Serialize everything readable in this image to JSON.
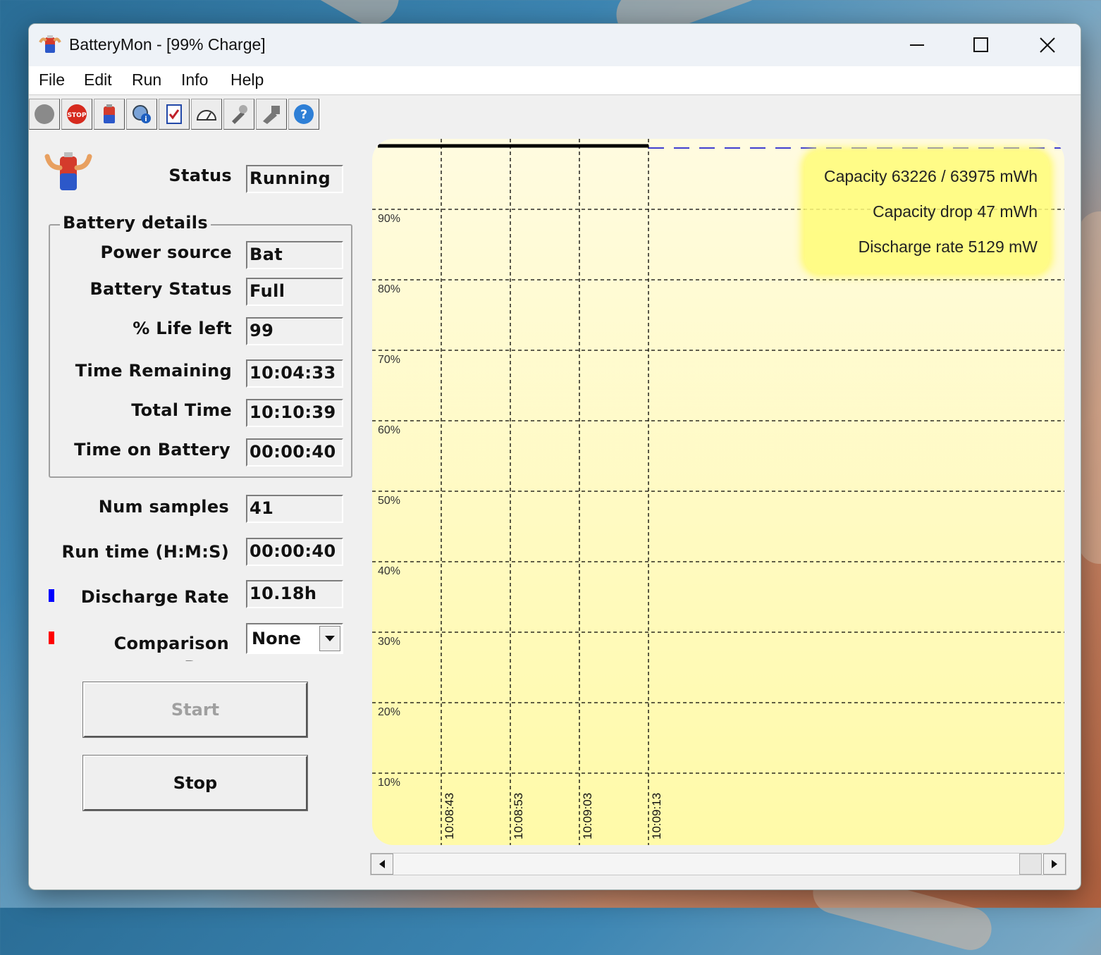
{
  "window": {
    "title": "BatteryMon - [99% Charge]",
    "minimize_icon": "minimize-icon",
    "maximize_icon": "maximize-icon",
    "close_icon": "close-icon"
  },
  "menu": [
    "File",
    "Edit",
    "Run",
    "Info",
    "Help"
  ],
  "toolbar": {
    "buttons": [
      "record-icon",
      "stop-icon",
      "battery-icon",
      "settings-icon",
      "checklist-icon",
      "gauge-icon",
      "tools-icon",
      "tools-gray-icon",
      "help-icon"
    ]
  },
  "status": {
    "label": "Status",
    "value": "Running"
  },
  "battery_details": {
    "title": "Battery details",
    "rows": [
      {
        "label": "Power source",
        "value": "Bat"
      },
      {
        "label": "Battery Status",
        "value": "Full"
      },
      {
        "label": "% Life left",
        "value": "99"
      },
      {
        "label": "Time Remaining",
        "value": "10:04:33"
      },
      {
        "label": "Total Time",
        "value": "10:10:39"
      },
      {
        "label": "Time on Battery",
        "value": "00:00:40"
      }
    ]
  },
  "stats": {
    "num_samples": {
      "label": "Num samples",
      "value": "41"
    },
    "run_time": {
      "label": "Run time (H:M:S)",
      "value": "00:00:40"
    },
    "discharge_rate": {
      "label": "Discharge Rate",
      "value": "10.18h",
      "color": "#0000ff"
    },
    "comparison": {
      "label": "Comparison Rate",
      "value": "None",
      "color": "#ff0000"
    }
  },
  "buttons": {
    "start": "Start",
    "stop": "Stop",
    "start_color": "#a0a0a0"
  },
  "chart_data": {
    "type": "line",
    "y_ticks": [
      "90%",
      "80%",
      "70%",
      "60%",
      "50%",
      "40%",
      "30%",
      "20%",
      "10%"
    ],
    "x_ticks": [
      "10:08:43",
      "10:08:53",
      "10:09:03",
      "10:09:13"
    ],
    "ylim": [
      0,
      100
    ],
    "grid": true,
    "series": [
      {
        "style": "solid",
        "color": "#000000",
        "x": [
          "10:08:33",
          "10:09:13"
        ],
        "values": [
          99,
          99
        ]
      },
      {
        "style": "dashed",
        "color": "#0000cc",
        "x": [
          "10:09:13",
          "10:10:43"
        ],
        "values": [
          99,
          99
        ]
      }
    ],
    "info_box": [
      "Capacity 63226 / 63975 mWh",
      "Capacity drop 47 mWh",
      "Discharge rate 5129 mW"
    ]
  }
}
